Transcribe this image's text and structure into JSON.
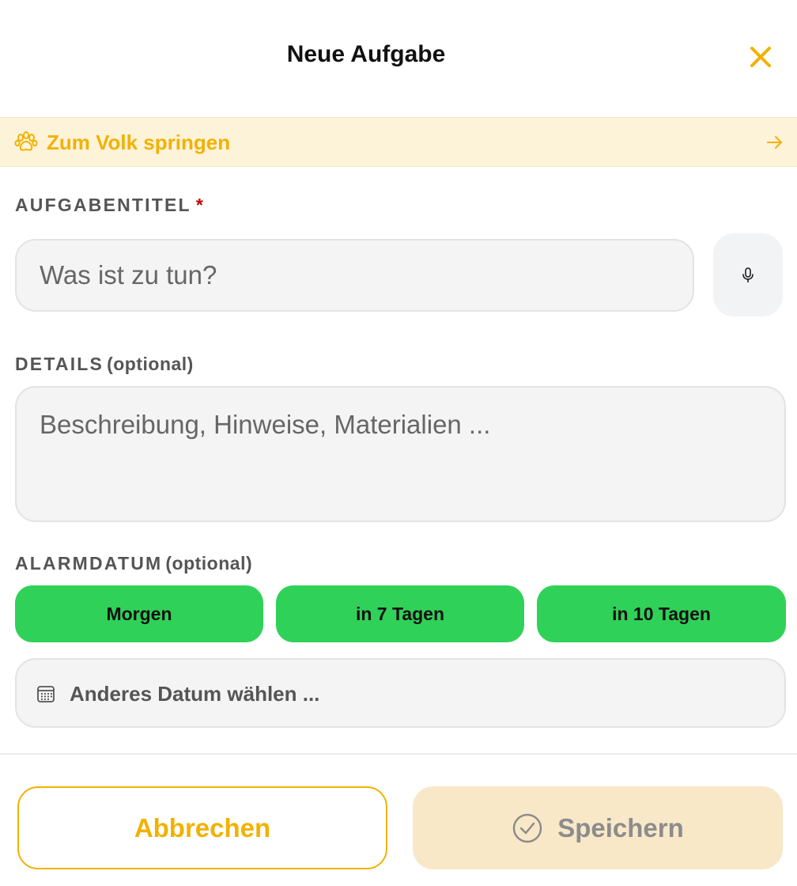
{
  "header": {
    "title": "Neue Aufgabe",
    "close_icon": "close-icon",
    "accent_color": "#f2b100"
  },
  "jump_banner": {
    "label": "Zum Volk springen",
    "icon": "paw-icon",
    "arrow_icon": "arrow-right-icon",
    "background_color": "#fdf3d9"
  },
  "task_title": {
    "label": "AUFGABENTITEL",
    "required_marker": "*",
    "placeholder": "Was ist zu tun?",
    "value": "",
    "mic_icon": "microphone-icon"
  },
  "details": {
    "label": "DETAILS",
    "optional_label": "(optional)",
    "placeholder": "Beschreibung, Hinweise, Materialien ...",
    "value": ""
  },
  "alarm_date": {
    "label": "ALARMDATUM",
    "optional_label": "(optional)",
    "presets": [
      {
        "label": "Morgen"
      },
      {
        "label": "in 7 Tagen"
      },
      {
        "label": "in 10 Tagen"
      }
    ],
    "preset_color": "#30d158",
    "custom_date_label": "Anderes Datum wählen ...",
    "calendar_icon": "calendar-icon"
  },
  "actions": {
    "cancel_label": "Abbrechen",
    "save_label": "Speichern",
    "save_icon": "check-circle-icon",
    "save_disabled": true
  }
}
